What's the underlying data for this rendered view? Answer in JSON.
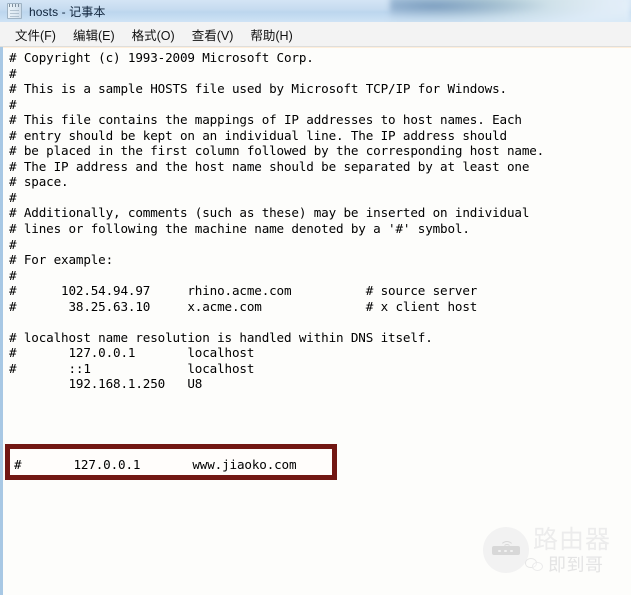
{
  "window": {
    "title": "hosts - 记事本",
    "icon": "notepad-icon"
  },
  "menubar": {
    "items": [
      {
        "label": "文件(F)",
        "name": "menu-file"
      },
      {
        "label": "编辑(E)",
        "name": "menu-edit"
      },
      {
        "label": "格式(O)",
        "name": "menu-format"
      },
      {
        "label": "查看(V)",
        "name": "menu-view"
      },
      {
        "label": "帮助(H)",
        "name": "menu-help"
      }
    ]
  },
  "editor": {
    "content": "# Copyright (c) 1993-2009 Microsoft Corp.\n#\n# This is a sample HOSTS file used by Microsoft TCP/IP for Windows.\n#\n# This file contains the mappings of IP addresses to host names. Each\n# entry should be kept on an individual line. The IP address should\n# be placed in the first column followed by the corresponding host name.\n# The IP address and the host name should be separated by at least one\n# space.\n#\n# Additionally, comments (such as these) may be inserted on individual\n# lines or following the machine name denoted by a '#' symbol.\n#\n# For example:\n#\n#      102.54.94.97     rhino.acme.com          # source server\n#       38.25.63.10     x.acme.com              # x client host\n\n# localhost name resolution is handled within DNS itself.\n#       127.0.0.1       localhost\n#       ::1             localhost\n        192.168.1.250   U8",
    "highlighted_line": "#       127.0.0.1       www.jiaoko.com"
  },
  "annotation": {
    "box_color": "#721713",
    "name": "red-highlight-box"
  },
  "watermark": {
    "title": "路由器",
    "subtitle": "即到哥",
    "icon": "router-icon",
    "sub_icon": "wechat-icon"
  }
}
